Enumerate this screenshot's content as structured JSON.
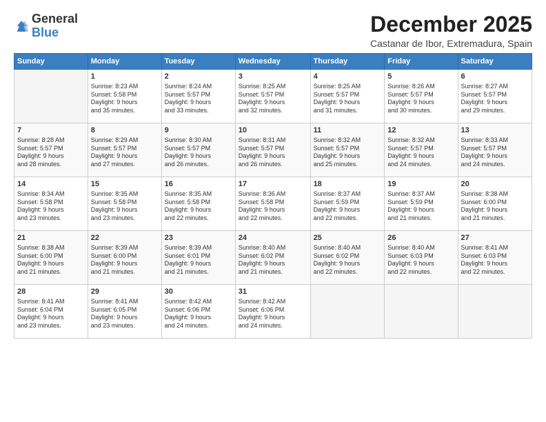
{
  "logo": {
    "general": "General",
    "blue": "Blue"
  },
  "title": "December 2025",
  "location": "Castanar de Ibor, Extremadura, Spain",
  "headers": [
    "Sunday",
    "Monday",
    "Tuesday",
    "Wednesday",
    "Thursday",
    "Friday",
    "Saturday"
  ],
  "weeks": [
    [
      {
        "day": "",
        "content": ""
      },
      {
        "day": "1",
        "content": "Sunrise: 8:23 AM\nSunset: 5:58 PM\nDaylight: 9 hours\nand 35 minutes."
      },
      {
        "day": "2",
        "content": "Sunrise: 8:24 AM\nSunset: 5:57 PM\nDaylight: 9 hours\nand 33 minutes."
      },
      {
        "day": "3",
        "content": "Sunrise: 8:25 AM\nSunset: 5:57 PM\nDaylight: 9 hours\nand 32 minutes."
      },
      {
        "day": "4",
        "content": "Sunrise: 8:25 AM\nSunset: 5:57 PM\nDaylight: 9 hours\nand 31 minutes."
      },
      {
        "day": "5",
        "content": "Sunrise: 8:26 AM\nSunset: 5:57 PM\nDaylight: 9 hours\nand 30 minutes."
      },
      {
        "day": "6",
        "content": "Sunrise: 8:27 AM\nSunset: 5:57 PM\nDaylight: 9 hours\nand 29 minutes."
      }
    ],
    [
      {
        "day": "7",
        "content": "Sunrise: 8:28 AM\nSunset: 5:57 PM\nDaylight: 9 hours\nand 28 minutes."
      },
      {
        "day": "8",
        "content": "Sunrise: 8:29 AM\nSunset: 5:57 PM\nDaylight: 9 hours\nand 27 minutes."
      },
      {
        "day": "9",
        "content": "Sunrise: 8:30 AM\nSunset: 5:57 PM\nDaylight: 9 hours\nand 26 minutes."
      },
      {
        "day": "10",
        "content": "Sunrise: 8:31 AM\nSunset: 5:57 PM\nDaylight: 9 hours\nand 26 minutes."
      },
      {
        "day": "11",
        "content": "Sunrise: 8:32 AM\nSunset: 5:57 PM\nDaylight: 9 hours\nand 25 minutes."
      },
      {
        "day": "12",
        "content": "Sunrise: 8:32 AM\nSunset: 5:57 PM\nDaylight: 9 hours\nand 24 minutes."
      },
      {
        "day": "13",
        "content": "Sunrise: 8:33 AM\nSunset: 5:57 PM\nDaylight: 9 hours\nand 24 minutes."
      }
    ],
    [
      {
        "day": "14",
        "content": "Sunrise: 8:34 AM\nSunset: 5:58 PM\nDaylight: 9 hours\nand 23 minutes."
      },
      {
        "day": "15",
        "content": "Sunrise: 8:35 AM\nSunset: 5:58 PM\nDaylight: 9 hours\nand 23 minutes."
      },
      {
        "day": "16",
        "content": "Sunrise: 8:35 AM\nSunset: 5:58 PM\nDaylight: 9 hours\nand 22 minutes."
      },
      {
        "day": "17",
        "content": "Sunrise: 8:36 AM\nSunset: 5:58 PM\nDaylight: 9 hours\nand 22 minutes."
      },
      {
        "day": "18",
        "content": "Sunrise: 8:37 AM\nSunset: 5:59 PM\nDaylight: 9 hours\nand 22 minutes."
      },
      {
        "day": "19",
        "content": "Sunrise: 8:37 AM\nSunset: 5:59 PM\nDaylight: 9 hours\nand 21 minutes."
      },
      {
        "day": "20",
        "content": "Sunrise: 8:38 AM\nSunset: 6:00 PM\nDaylight: 9 hours\nand 21 minutes."
      }
    ],
    [
      {
        "day": "21",
        "content": "Sunrise: 8:38 AM\nSunset: 6:00 PM\nDaylight: 9 hours\nand 21 minutes."
      },
      {
        "day": "22",
        "content": "Sunrise: 8:39 AM\nSunset: 6:00 PM\nDaylight: 9 hours\nand 21 minutes."
      },
      {
        "day": "23",
        "content": "Sunrise: 8:39 AM\nSunset: 6:01 PM\nDaylight: 9 hours\nand 21 minutes."
      },
      {
        "day": "24",
        "content": "Sunrise: 8:40 AM\nSunset: 6:02 PM\nDaylight: 9 hours\nand 21 minutes."
      },
      {
        "day": "25",
        "content": "Sunrise: 8:40 AM\nSunset: 6:02 PM\nDaylight: 9 hours\nand 22 minutes."
      },
      {
        "day": "26",
        "content": "Sunrise: 8:40 AM\nSunset: 6:03 PM\nDaylight: 9 hours\nand 22 minutes."
      },
      {
        "day": "27",
        "content": "Sunrise: 8:41 AM\nSunset: 6:03 PM\nDaylight: 9 hours\nand 22 minutes."
      }
    ],
    [
      {
        "day": "28",
        "content": "Sunrise: 8:41 AM\nSunset: 6:04 PM\nDaylight: 9 hours\nand 23 minutes."
      },
      {
        "day": "29",
        "content": "Sunrise: 8:41 AM\nSunset: 6:05 PM\nDaylight: 9 hours\nand 23 minutes."
      },
      {
        "day": "30",
        "content": "Sunrise: 8:42 AM\nSunset: 6:06 PM\nDaylight: 9 hours\nand 24 minutes."
      },
      {
        "day": "31",
        "content": "Sunrise: 8:42 AM\nSunset: 6:06 PM\nDaylight: 9 hours\nand 24 minutes."
      },
      {
        "day": "",
        "content": ""
      },
      {
        "day": "",
        "content": ""
      },
      {
        "day": "",
        "content": ""
      }
    ]
  ]
}
